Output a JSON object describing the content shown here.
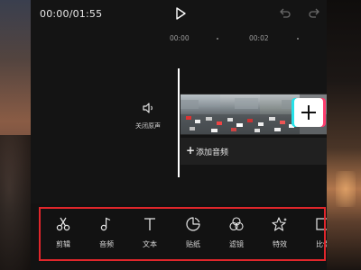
{
  "header": {
    "time_display": "00:00/01:55",
    "play_icon": "play-icon",
    "undo_icon": "undo-icon",
    "redo_icon": "redo-icon"
  },
  "ruler": {
    "labels": [
      "00:00",
      "00:02"
    ]
  },
  "track": {
    "mute_label": "关闭原声",
    "mute_icon": "speaker-icon",
    "add_clip_icon": "plus-icon",
    "add_audio_label": "添加音频"
  },
  "toolbar": {
    "items": [
      {
        "label": "剪辑",
        "icon": "scissors-icon"
      },
      {
        "label": "音频",
        "icon": "music-note-icon"
      },
      {
        "label": "文本",
        "icon": "text-icon"
      },
      {
        "label": "贴纸",
        "icon": "sticker-icon"
      },
      {
        "label": "滤镜",
        "icon": "filter-icon"
      },
      {
        "label": "特效",
        "icon": "effects-icon"
      },
      {
        "label": "比例",
        "icon": "aspect-ratio-icon"
      }
    ]
  },
  "colors": {
    "highlight": "#e0262b",
    "accent_cyan": "#27e1e8",
    "accent_pink": "#ff3d6e"
  }
}
